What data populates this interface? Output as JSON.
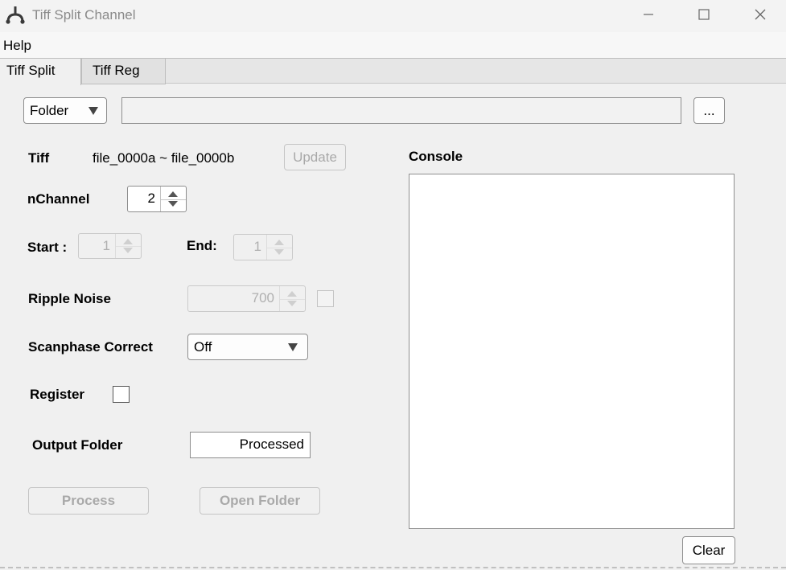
{
  "window": {
    "title": "Tiff Split Channel",
    "icons": {
      "app": "app-logo-icon",
      "minimize": "minimize-icon",
      "maximize": "maximize-icon",
      "close": "close-icon"
    }
  },
  "menu": {
    "help": "Help"
  },
  "tabs": [
    {
      "label": "Tiff Split",
      "active": true
    },
    {
      "label": "Tiff Reg",
      "active": false
    }
  ],
  "source": {
    "type_selected": "Folder",
    "path_value": "",
    "browse_label": "..."
  },
  "form": {
    "tiff_label": "Tiff",
    "tiff_value": "file_0000a ~ file_0000b",
    "update_label": "Update",
    "nchannel_label": "nChannel",
    "nchannel_value": "2",
    "start_label": "Start :",
    "start_value": "1",
    "end_label": "End:",
    "end_value": "1",
    "ripple_label": "Ripple Noise",
    "ripple_value": "700",
    "ripple_checked": false,
    "scanphase_label": "Scanphase Correct",
    "scanphase_value": "Off",
    "register_label": "Register",
    "register_checked": false,
    "output_label": "Output Folder",
    "output_value": "Processed",
    "process_label": "Process",
    "open_folder_label": "Open Folder"
  },
  "console": {
    "label": "Console",
    "content": "",
    "clear_label": "Clear"
  }
}
